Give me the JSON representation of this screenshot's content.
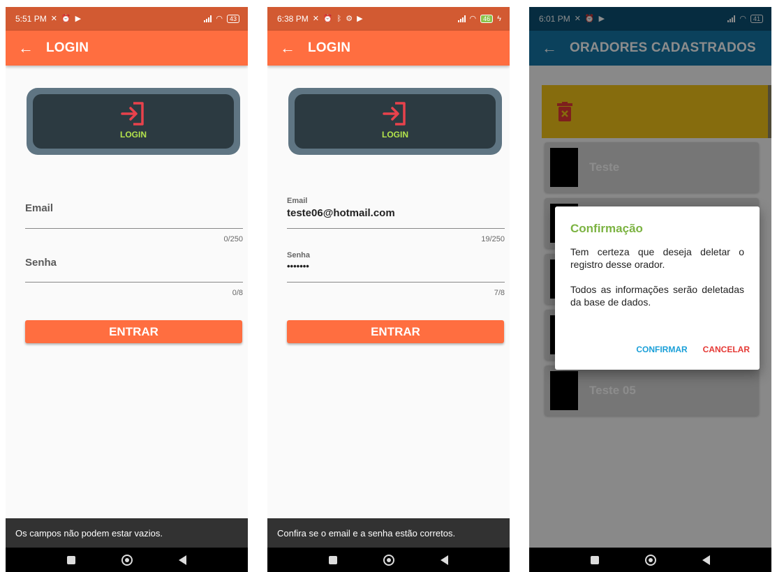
{
  "screens": [
    {
      "status_time": "5:51 PM",
      "battery": "43",
      "title": "LOGIN",
      "logo_label": "LOGIN",
      "email_label": "Email",
      "email_value": "",
      "email_counter": "0/250",
      "password_label": "Senha",
      "password_value": "",
      "password_counter": "0/8",
      "button_label": "ENTRAR",
      "snackbar": "Os campos não podem estar vazios."
    },
    {
      "status_time": "6:38 PM",
      "battery": "46",
      "title": "LOGIN",
      "logo_label": "LOGIN",
      "email_label": "Email",
      "email_value": "teste06@hotmail.com",
      "email_counter": "19/250",
      "password_label": "Senha",
      "password_value": "•••••••",
      "password_counter": "7/8",
      "button_label": "ENTRAR",
      "snackbar": "Confira se o email e a senha estão corretos."
    }
  ],
  "list_screen": {
    "status_time": "6:01 PM",
    "battery": "41",
    "title": "ORADORES CADASTRADOS",
    "items": [
      "Teste",
      "",
      "",
      "",
      "Teste 05"
    ],
    "dialog": {
      "title": "Confirmação",
      "message": "Tem certeza que deseja deletar o registro desse orador.",
      "message2": "Todos as informações serão deletadas da base de dados.",
      "confirm": "CONFIRMAR",
      "cancel": "CANCELAR"
    }
  },
  "colors": {
    "login_appbar": "#ff6e40",
    "login_status": "#d25a32",
    "list_appbar": "#1477a8",
    "logo_accent": "#b3e34c",
    "dialog_title": "#7cb342",
    "confirm": "#1a9fd8",
    "cancel": "#e53935",
    "delete_swipe": "#f5c518"
  },
  "icons": {
    "back": "arrow-left-icon",
    "login": "login-icon",
    "trash": "trash-icon",
    "nav_recent": "square-icon",
    "nav_home": "circle-icon",
    "nav_back": "triangle-back-icon"
  }
}
